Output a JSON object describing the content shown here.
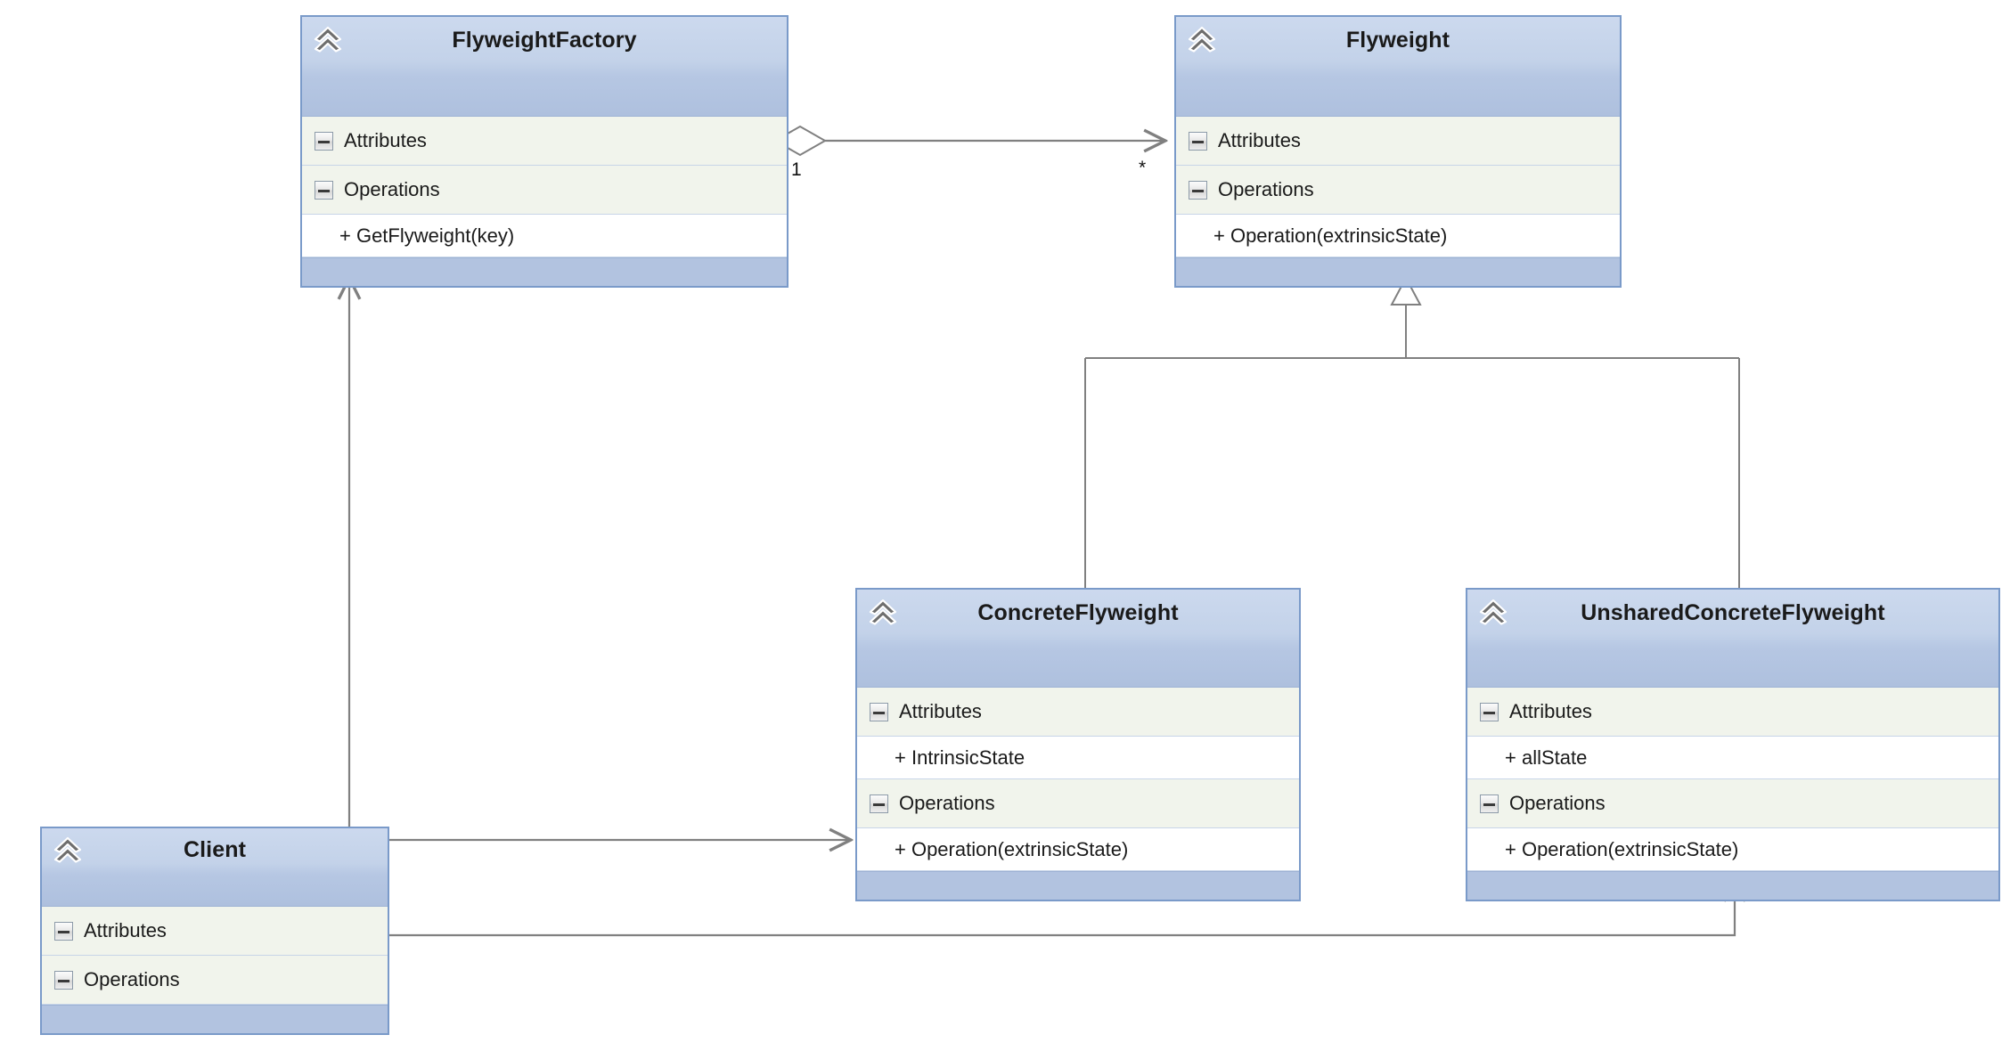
{
  "diagram": {
    "type": "uml-class-diagram",
    "pattern": "Flyweight",
    "background": "#ffffff",
    "colors": {
      "class_border": "#7a9ac9",
      "header_gradient_top": "#ccd9ee",
      "header_gradient_bottom": "#aec0de",
      "section_background": "#f1f4ec",
      "member_background": "#ffffff",
      "footer_background": "#b2c3e0",
      "connector": "#808080",
      "text": "#1a1a1a"
    }
  },
  "classes": [
    {
      "id": "flyweightfactory",
      "name": "FlyweightFactory",
      "icon": "class-chevron-icon",
      "attributes_label": "Attributes",
      "attributes": [],
      "operations_label": "Operations",
      "operations": [
        "+ GetFlyweight(key)"
      ]
    },
    {
      "id": "flyweight",
      "name": "Flyweight",
      "icon": "class-chevron-icon",
      "attributes_label": "Attributes",
      "attributes": [],
      "operations_label": "Operations",
      "operations": [
        "+ Operation(extrinsicState)"
      ]
    },
    {
      "id": "concreteflyweight",
      "name": "ConcreteFlyweight",
      "icon": "class-chevron-icon",
      "attributes_label": "Attributes",
      "attributes": [
        "+ IntrinsicState"
      ],
      "operations_label": "Operations",
      "operations": [
        "+ Operation(extrinsicState)"
      ]
    },
    {
      "id": "unsharedconcreteflyweight",
      "name": "UnsharedConcreteFlyweight",
      "icon": "class-chevron-icon",
      "attributes_label": "Attributes",
      "attributes": [
        "+ allState"
      ],
      "operations_label": "Operations",
      "operations": [
        "+ Operation(extrinsicState)"
      ]
    },
    {
      "id": "client",
      "name": "Client",
      "icon": "class-chevron-icon",
      "attributes_label": "Attributes",
      "attributes": [],
      "operations_label": "Operations",
      "operations": []
    }
  ],
  "relationships": [
    {
      "id": "factory-aggregates-flyweight",
      "type": "aggregation",
      "from": "FlyweightFactory",
      "to": "Flyweight",
      "source_multiplicity": "1",
      "target_multiplicity": "*",
      "source_decoration": "hollow-diamond",
      "target_decoration": "open-arrow"
    },
    {
      "id": "concreteflyweight-inherits-flyweight",
      "type": "generalization",
      "from": "ConcreteFlyweight",
      "to": "Flyweight",
      "target_decoration": "hollow-triangle"
    },
    {
      "id": "unsharedconcreteflyweight-inherits-flyweight",
      "type": "generalization",
      "from": "UnsharedConcreteFlyweight",
      "to": "Flyweight",
      "target_decoration": "hollow-triangle"
    },
    {
      "id": "client-uses-factory",
      "type": "association",
      "from": "Client",
      "to": "FlyweightFactory",
      "target_decoration": "open-arrow"
    },
    {
      "id": "client-uses-concreteflyweight",
      "type": "association",
      "from": "Client",
      "to": "ConcreteFlyweight",
      "target_decoration": "open-arrow"
    },
    {
      "id": "client-uses-unsharedconcreteflyweight",
      "type": "association",
      "from": "Client",
      "to": "UnsharedConcreteFlyweight",
      "target_decoration": "open-arrow"
    }
  ],
  "edge_labels": {
    "aggregation_source": "1",
    "aggregation_target": "*"
  }
}
